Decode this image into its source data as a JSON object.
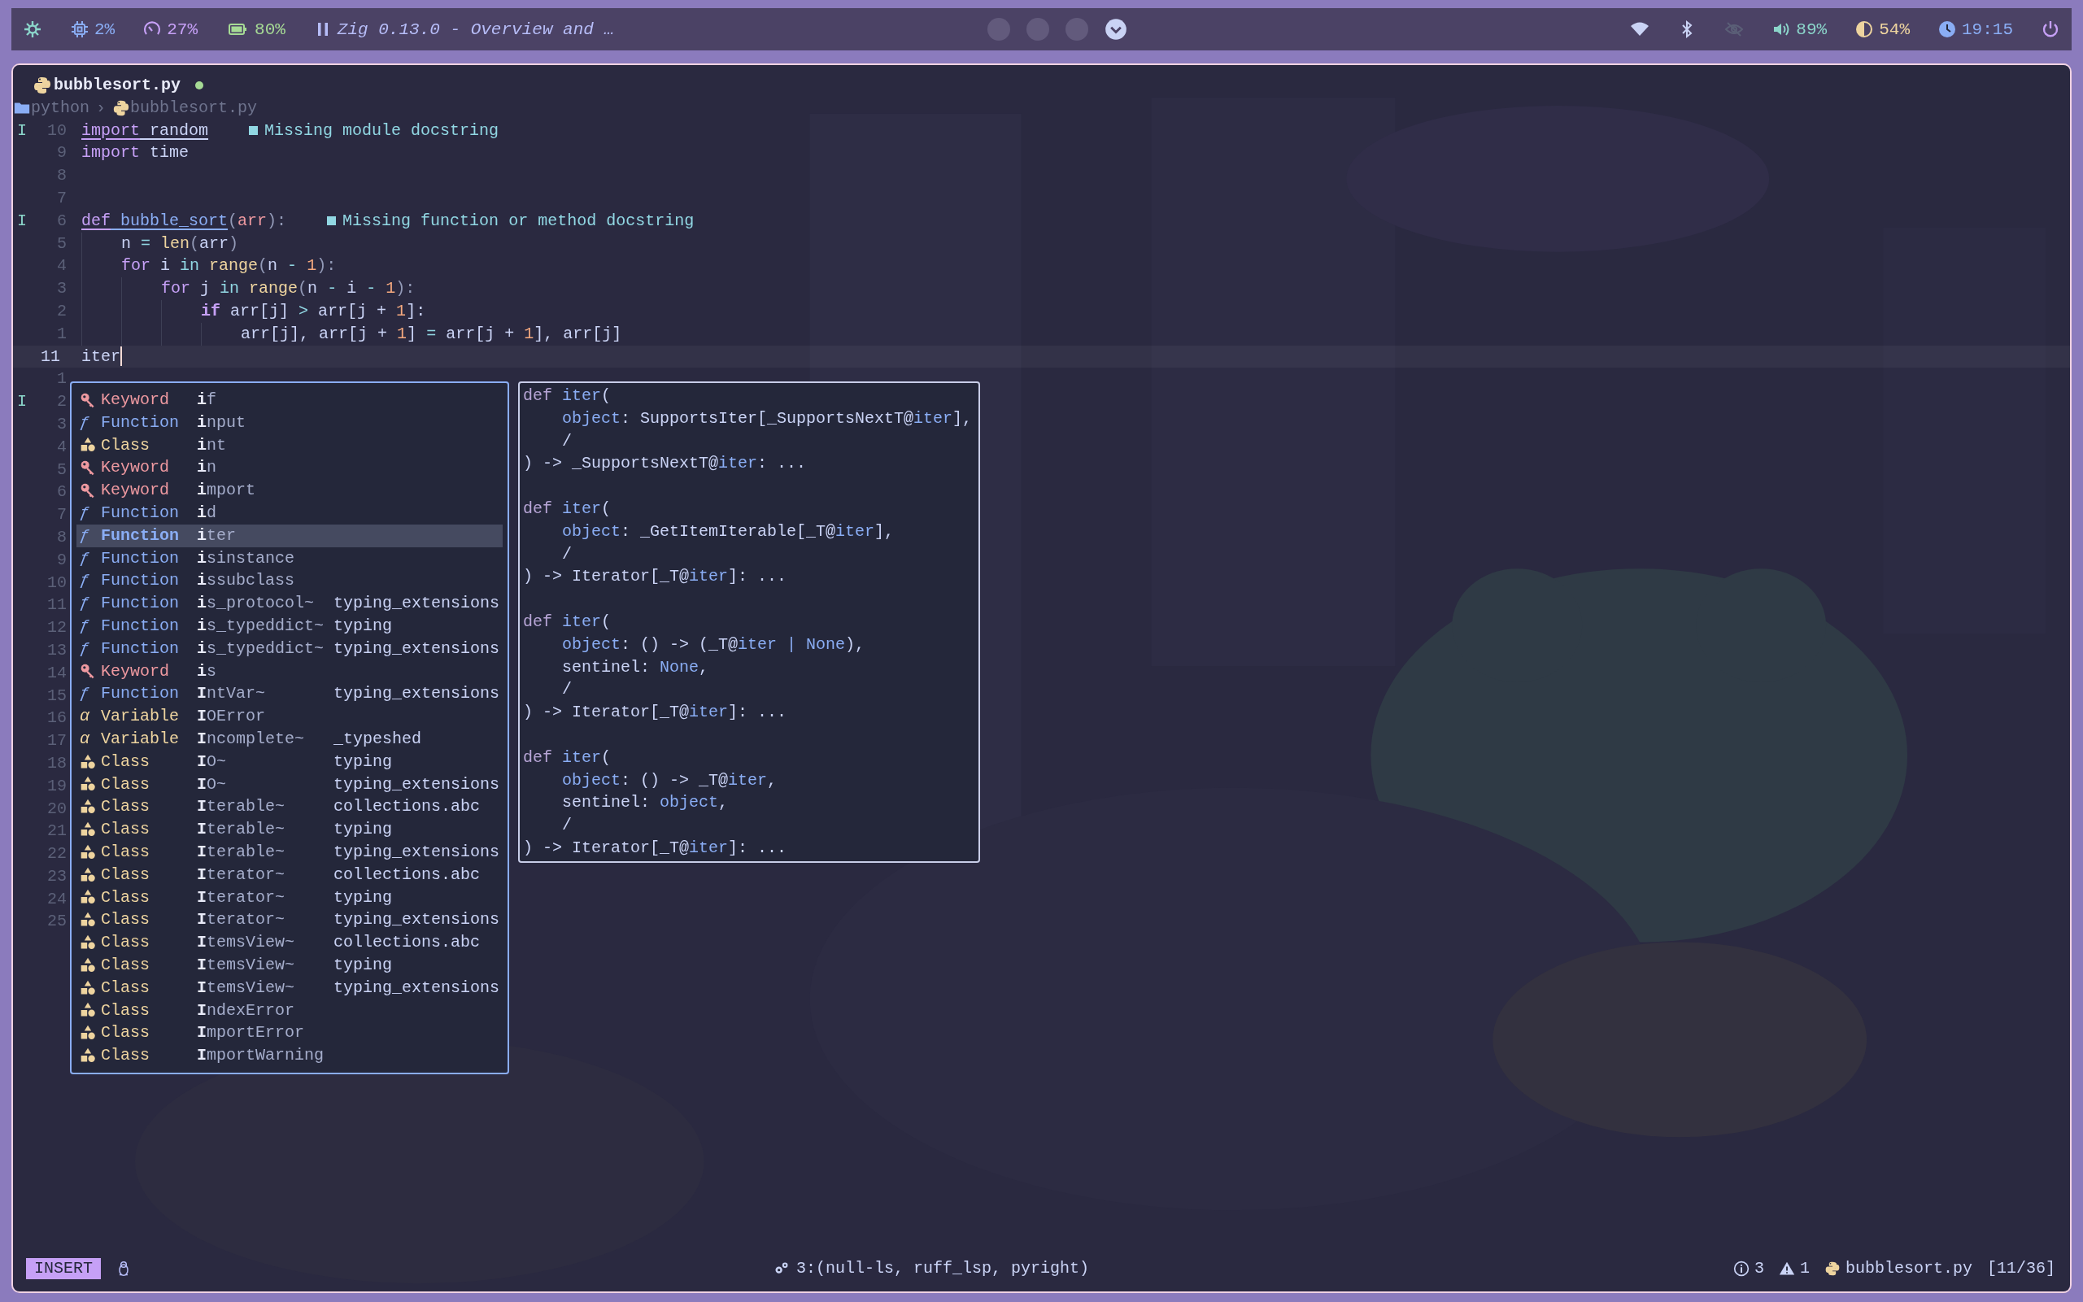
{
  "top_bar": {
    "left": [
      {
        "kind": "logo"
      },
      {
        "kind": "cpu",
        "text": "2%"
      },
      {
        "kind": "gauge",
        "text": "27%"
      },
      {
        "kind": "battery",
        "text": "80%"
      },
      {
        "kind": "media",
        "text": "Zig 0.13.0 - Overview and …"
      }
    ],
    "workspaces": [
      {
        "selected": false
      },
      {
        "selected": false
      },
      {
        "selected": false
      },
      {
        "selected": true
      }
    ],
    "right": [
      {
        "kind": "wifi"
      },
      {
        "kind": "bluetooth"
      },
      {
        "kind": "privacy"
      },
      {
        "kind": "volume",
        "text": "89%"
      },
      {
        "kind": "brightness",
        "text": "54%"
      },
      {
        "kind": "clock",
        "text": "19:15"
      },
      {
        "kind": "power"
      }
    ]
  },
  "tab": {
    "title": "bubblesort.py",
    "modified": true
  },
  "breadcrumb": {
    "separator": "›",
    "items": [
      {
        "kind": "folder",
        "text": "python"
      },
      {
        "kind": "file",
        "text": "bubblesort.py"
      }
    ]
  },
  "lines": [
    {
      "sign": "I",
      "number": "10",
      "current": false,
      "tokens": [
        {
          "text": "import",
          "kind": "kw",
          "underline": true
        },
        {
          "text": " random",
          "kind": "text",
          "underline": true
        }
      ],
      "diagnostic": "Missing module docstring"
    },
    {
      "number": "9",
      "current": false,
      "tokens": [
        {
          "text": "import",
          "kind": "kw"
        },
        {
          "text": " time",
          "kind": "text"
        }
      ]
    },
    {
      "number": "8",
      "current": false
    },
    {
      "number": "7",
      "current": false
    },
    {
      "sign": "I",
      "number": "6",
      "current": false,
      "tokens": [
        {
          "text": "def",
          "kind": "kw",
          "underline": true
        },
        {
          "text": " bubble_sort",
          "kind": "fn",
          "underline": true
        },
        {
          "text": "(",
          "kind": "punc"
        },
        {
          "text": "arr",
          "kind": "param"
        },
        {
          "text": "):",
          "kind": "punc"
        }
      ],
      "diagnostic": "Missing function or method docstring"
    },
    {
      "number": "5",
      "current": false,
      "tokens": [
        {
          "text": "    n ",
          "kind": "text"
        },
        {
          "text": "= ",
          "kind": "op"
        },
        {
          "text": "len",
          "kind": "builtin"
        },
        {
          "text": "(",
          "kind": "punc"
        },
        {
          "text": "arr",
          "kind": "text"
        },
        {
          "text": ")",
          "kind": "punc"
        }
      ]
    },
    {
      "number": "4",
      "current": false,
      "tokens": [
        {
          "text": "    for",
          "kind": "kw"
        },
        {
          "text": " i ",
          "kind": "text"
        },
        {
          "text": "in ",
          "kind": "op"
        },
        {
          "text": "range",
          "kind": "builtin"
        },
        {
          "text": "(",
          "kind": "punc"
        },
        {
          "text": "n ",
          "kind": "text"
        },
        {
          "text": "- ",
          "kind": "op"
        },
        {
          "text": "1",
          "kind": "num"
        },
        {
          "text": "):",
          "kind": "punc"
        }
      ]
    },
    {
      "number": "3",
      "current": false,
      "tokens": [
        {
          "text": "        for",
          "kind": "kw"
        },
        {
          "text": " j ",
          "kind": "text"
        },
        {
          "text": "in ",
          "kind": "op"
        },
        {
          "text": "range",
          "kind": "builtin"
        },
        {
          "text": "(",
          "kind": "punc"
        },
        {
          "text": "n ",
          "kind": "text"
        },
        {
          "text": "- ",
          "kind": "op"
        },
        {
          "text": "i ",
          "kind": "text"
        },
        {
          "text": "- ",
          "kind": "op"
        },
        {
          "text": "1",
          "kind": "num"
        },
        {
          "text": "):",
          "kind": "punc"
        }
      ]
    },
    {
      "number": "2",
      "current": false,
      "tokens": [
        {
          "text": "            if",
          "kind": "kwb"
        },
        {
          "text": " arr[j] ",
          "kind": "text"
        },
        {
          "text": "> ",
          "kind": "op"
        },
        {
          "text": "arr[j + ",
          "kind": "text"
        },
        {
          "text": "1",
          "kind": "num"
        },
        {
          "text": "]:",
          "kind": "text"
        }
      ]
    },
    {
      "number": "1",
      "current": false,
      "tokens": [
        {
          "text": "                arr[j], arr[j + ",
          "kind": "text"
        },
        {
          "text": "1",
          "kind": "num"
        },
        {
          "text": "] ",
          "kind": "text"
        },
        {
          "text": "= ",
          "kind": "op"
        },
        {
          "text": "arr[j + ",
          "kind": "text"
        },
        {
          "text": "1",
          "kind": "num"
        },
        {
          "text": "], arr[j]",
          "kind": "text"
        }
      ]
    },
    {
      "number": "11",
      "current": true,
      "tokens": [
        {
          "text": "iter",
          "kind": "text"
        }
      ]
    },
    {
      "number": "1",
      "current": false
    },
    {
      "sign": "I",
      "number": "2",
      "current": false
    },
    {
      "number": "3",
      "current": false
    },
    {
      "number": "4",
      "current": false
    },
    {
      "number": "5",
      "current": false
    },
    {
      "number": "6",
      "current": false
    },
    {
      "number": "7",
      "current": false
    },
    {
      "number": "8",
      "current": false
    },
    {
      "number": "9",
      "current": false
    },
    {
      "number": "10",
      "current": false
    },
    {
      "number": "11",
      "current": false
    },
    {
      "number": "12",
      "current": false
    },
    {
      "number": "13",
      "current": false
    },
    {
      "number": "14",
      "current": false
    },
    {
      "number": "15",
      "current": false
    },
    {
      "number": "16",
      "current": false
    },
    {
      "number": "17",
      "current": false
    },
    {
      "number": "18",
      "current": false
    },
    {
      "number": "19",
      "current": false
    },
    {
      "number": "20",
      "current": false
    },
    {
      "number": "21",
      "current": false
    },
    {
      "number": "22",
      "current": false
    },
    {
      "number": "23",
      "current": false
    },
    {
      "number": "24",
      "current": false
    },
    {
      "number": "25",
      "current": false
    }
  ],
  "completion": {
    "items": [
      {
        "kind": "keyword",
        "label": "Keyword",
        "name": "**i**f",
        "selected": false
      },
      {
        "kind": "function",
        "icon": "ƒ",
        "label": "Function",
        "name": "**i**nput",
        "selected": false
      },
      {
        "kind": "class",
        "label": "Class",
        "name": "**i**nt",
        "selected": false
      },
      {
        "kind": "keyword",
        "label": "Keyword",
        "name": "**i**n",
        "selected": false
      },
      {
        "kind": "keyword",
        "label": "Keyword",
        "name": "**i**mport",
        "selected": false
      },
      {
        "kind": "function",
        "icon": "ƒ",
        "label": "Function",
        "name": "**i**d",
        "selected": false
      },
      {
        "kind": "function",
        "icon": "ƒ",
        "label": "Function",
        "name": "**i**ter",
        "selected": true
      },
      {
        "kind": "function",
        "icon": "ƒ",
        "label": "Function",
        "name": "**i**sinstance",
        "selected": false
      },
      {
        "kind": "function",
        "icon": "ƒ",
        "label": "Function",
        "name": "**i**ssubclass",
        "selected": false
      },
      {
        "kind": "function",
        "icon": "ƒ",
        "label": "Function",
        "name": "**i**s_protocol~",
        "source": "typing_extensions",
        "selected": false
      },
      {
        "kind": "function",
        "icon": "ƒ",
        "label": "Function",
        "name": "**i**s_typeddict~",
        "source": "typing",
        "selected": false
      },
      {
        "kind": "function",
        "icon": "ƒ",
        "label": "Function",
        "name": "**i**s_typeddict~",
        "source": "typing_extensions",
        "selected": false
      },
      {
        "kind": "keyword",
        "label": "Keyword",
        "name": "**i**s",
        "selected": false
      },
      {
        "kind": "function",
        "icon": "ƒ",
        "label": "Function",
        "name": "**I**ntVar~",
        "source": "typing_extensions",
        "selected": false
      },
      {
        "kind": "variable",
        "icon": "α",
        "label": "Variable",
        "name": "**I**OError",
        "selected": false
      },
      {
        "kind": "variable",
        "icon": "α",
        "label": "Variable",
        "name": "**I**ncomplete~",
        "source": "_typeshed",
        "selected": false
      },
      {
        "kind": "class",
        "label": "Class",
        "name": "**I**O~",
        "source": "typing",
        "selected": false
      },
      {
        "kind": "class",
        "label": "Class",
        "name": "**I**O~",
        "source": "typing_extensions",
        "selected": false
      },
      {
        "kind": "class",
        "label": "Class",
        "name": "**I**terable~",
        "source": "collections.abc",
        "selected": false
      },
      {
        "kind": "class",
        "label": "Class",
        "name": "**I**terable~",
        "source": "typing",
        "selected": false
      },
      {
        "kind": "class",
        "label": "Class",
        "name": "**I**terable~",
        "source": "typing_extensions",
        "selected": false
      },
      {
        "kind": "class",
        "label": "Class",
        "name": "**I**terator~",
        "source": "collections.abc",
        "selected": false
      },
      {
        "kind": "class",
        "label": "Class",
        "name": "**I**terator~",
        "source": "typing",
        "selected": false
      },
      {
        "kind": "class",
        "label": "Class",
        "name": "**I**terator~",
        "source": "typing_extensions",
        "selected": false
      },
      {
        "kind": "class",
        "label": "Class",
        "name": "**I**temsView~",
        "source": "collections.abc",
        "selected": false
      },
      {
        "kind": "class",
        "label": "Class",
        "name": "**I**temsView~",
        "source": "typing",
        "selected": false
      },
      {
        "kind": "class",
        "label": "Class",
        "name": "**I**temsView~",
        "source": "typing_extensions",
        "selected": false
      },
      {
        "kind": "class",
        "label": "Class",
        "name": "**I**ndexError",
        "selected": false
      },
      {
        "kind": "class",
        "label": "Class",
        "name": "**I**mportError",
        "selected": false
      },
      {
        "kind": "class",
        "label": "Class",
        "name": "**I**mportWarning",
        "selected": false
      }
    ]
  },
  "documentation": {
    "signatures": [
      {
        "lines": [
          {
            "tokens": [
              {
                "text": "def",
                "kind": "kw"
              },
              {
                "text": " iter",
                "kind": "fn"
              },
              {
                "text": "(",
                "kind": "text"
              }
            ]
          },
          {
            "tokens": [
              {
                "text": "    object",
                "kind": "fn"
              },
              {
                "text": ": SupportsIter[_SupportsNextT@",
                "kind": "text"
              },
              {
                "text": "iter",
                "kind": "fn"
              },
              {
                "text": "],",
                "kind": "text"
              }
            ]
          },
          {
            "tokens": [
              {
                "text": "    /",
                "kind": "text"
              }
            ]
          },
          {
            "tokens": [
              {
                "text": ") -> _SupportsNextT@",
                "kind": "text"
              },
              {
                "text": "iter",
                "kind": "fn"
              },
              {
                "text": ": ...",
                "kind": "text"
              }
            ]
          }
        ]
      },
      {
        "lines": [
          {
            "tokens": [
              {
                "text": "def",
                "kind": "kw"
              },
              {
                "text": " iter",
                "kind": "fn"
              },
              {
                "text": "(",
                "kind": "text"
              }
            ]
          },
          {
            "tokens": [
              {
                "text": "    object",
                "kind": "fn"
              },
              {
                "text": ": _GetItemIterable[_T@",
                "kind": "text"
              },
              {
                "text": "iter",
                "kind": "fn"
              },
              {
                "text": "],",
                "kind": "text"
              }
            ]
          },
          {
            "tokens": [
              {
                "text": "    /",
                "kind": "text"
              }
            ]
          },
          {
            "tokens": [
              {
                "text": ") -> Iterator[_T@",
                "kind": "text"
              },
              {
                "text": "iter",
                "kind": "fn"
              },
              {
                "text": "]: ...",
                "kind": "text"
              }
            ]
          }
        ]
      },
      {
        "lines": [
          {
            "tokens": [
              {
                "text": "def",
                "kind": "kw"
              },
              {
                "text": " iter",
                "kind": "fn"
              },
              {
                "text": "(",
                "kind": "text"
              }
            ]
          },
          {
            "tokens": [
              {
                "text": "    object",
                "kind": "fn"
              },
              {
                "text": ": () -> (_T@",
                "kind": "text"
              },
              {
                "text": "iter | None",
                "kind": "fn"
              },
              {
                "text": "),",
                "kind": "text"
              }
            ]
          },
          {
            "tokens": [
              {
                "text": "    sentinel: ",
                "kind": "text"
              },
              {
                "text": "None",
                "kind": "fn"
              },
              {
                "text": ",",
                "kind": "text"
              }
            ]
          },
          {
            "tokens": [
              {
                "text": "    /",
                "kind": "text"
              }
            ]
          },
          {
            "tokens": [
              {
                "text": ") -> Iterator[_T@",
                "kind": "text"
              },
              {
                "text": "iter",
                "kind": "fn"
              },
              {
                "text": "]: ...",
                "kind": "text"
              }
            ]
          }
        ]
      },
      {
        "lines": [
          {
            "tokens": [
              {
                "text": "def",
                "kind": "kw"
              },
              {
                "text": " iter",
                "kind": "fn"
              },
              {
                "text": "(",
                "kind": "text"
              }
            ]
          },
          {
            "tokens": [
              {
                "text": "    object",
                "kind": "fn"
              },
              {
                "text": ": () -> _T@",
                "kind": "text"
              },
              {
                "text": "iter",
                "kind": "fn"
              },
              {
                "text": ",",
                "kind": "text"
              }
            ]
          },
          {
            "tokens": [
              {
                "text": "    sentinel: ",
                "kind": "text"
              },
              {
                "text": "object",
                "kind": "fn"
              },
              {
                "text": ",",
                "kind": "text"
              }
            ]
          },
          {
            "tokens": [
              {
                "text": "    /",
                "kind": "text"
              }
            ]
          },
          {
            "tokens": [
              {
                "text": ") -> Iterator[_T@",
                "kind": "text"
              },
              {
                "text": "iter",
                "kind": "fn"
              },
              {
                "text": "]: ...",
                "kind": "text"
              }
            ]
          }
        ]
      }
    ]
  },
  "status_bar": {
    "mode": "INSERT",
    "lsp": "3:(null-ls, ruff_lsp, pyright)",
    "info": "3",
    "warnings": "1",
    "file": "bubblesort.py",
    "position": "[11/36]"
  }
}
